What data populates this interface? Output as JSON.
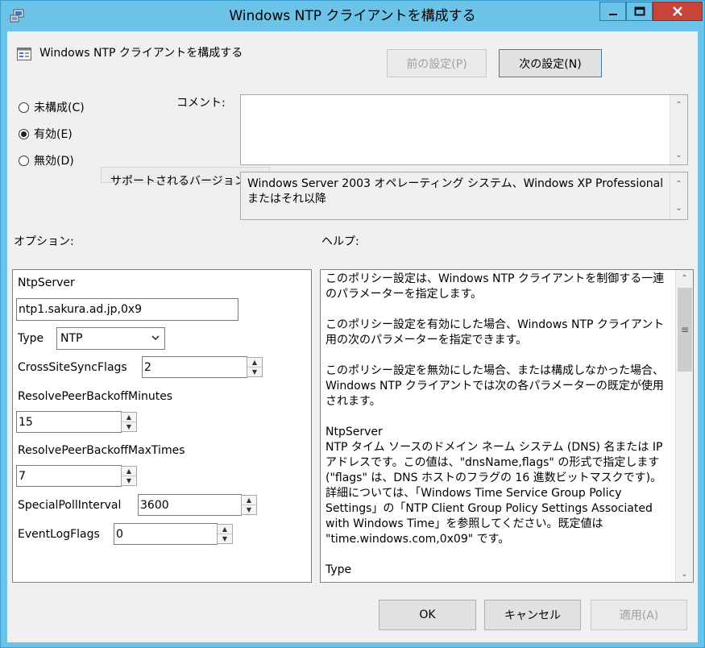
{
  "window": {
    "title": "Windows NTP クライアントを構成する"
  },
  "header": {
    "title": "Windows  NTP クライアントを構成する",
    "prev_label": "前の設定(P)",
    "next_label": "次の設定(N)"
  },
  "state": {
    "options": [
      {
        "label": "未構成(C)",
        "checked": false
      },
      {
        "label": "有効(E)",
        "checked": true
      },
      {
        "label": "無効(D)",
        "checked": false
      }
    ]
  },
  "comment": {
    "label": "コメント:",
    "value": ""
  },
  "supported": {
    "label": "サポートされるバージョン:",
    "value": "Windows Server 2003 オペレーティング システム、Windows XP Professional またはそれ以降"
  },
  "sections": {
    "options_label": "オプション:",
    "help_label": "ヘルプ:"
  },
  "options": {
    "ntpserver_label": "NtpServer",
    "ntpserver_value": "ntp1.sakura.ad.jp,0x9",
    "type_label": "Type",
    "type_value": "NTP",
    "crosssite_label": "CrossSiteSyncFlags",
    "crosssite_value": "2",
    "backoff_minutes_label": "ResolvePeerBackoffMinutes",
    "backoff_minutes_value": "15",
    "backoff_maxtimes_label": "ResolvePeerBackoffMaxTimes",
    "backoff_maxtimes_value": "7",
    "specialpoll_label": "SpecialPollInterval",
    "specialpoll_value": "3600",
    "eventlog_label": "EventLogFlags",
    "eventlog_value": "0"
  },
  "help": {
    "p1": "このポリシー設定は、Windows NTP クライアントを制御する一連のパラメーターを指定します。",
    "p2": "このポリシー設定を有効にした場合、Windows NTP クライアント用の次のパラメーターを指定できます。",
    "p3": "このポリシー設定を無効にした場合、または構成しなかった場合、Windows NTP クライアントでは次の各パラメーターの既定が使用されます。",
    "p4_title": "NtpServer",
    "p4": "NTP タイム ソースのドメイン ネーム システム (DNS) 名または IP アドレスです。この値は、\"dnsName,flags\" の形式で指定します (\"flags\" は、DNS ホストのフラグの 16 進数ビットマスクです)。詳細については、「Windows Time Service Group Policy Settings」の「NTP Client Group Policy Settings Associated with Windows Time」を参照してください。既定値は \"time.windows.com,0x09\" です。",
    "p5_title": "Type"
  },
  "footer": {
    "ok_label": "OK",
    "cancel_label": "キャンセル",
    "apply_label": "適用(A)"
  },
  "colors": {
    "titlebar": "#6cc3e8",
    "close_button": "#c7443a",
    "client_bg": "#f0f0f0"
  }
}
